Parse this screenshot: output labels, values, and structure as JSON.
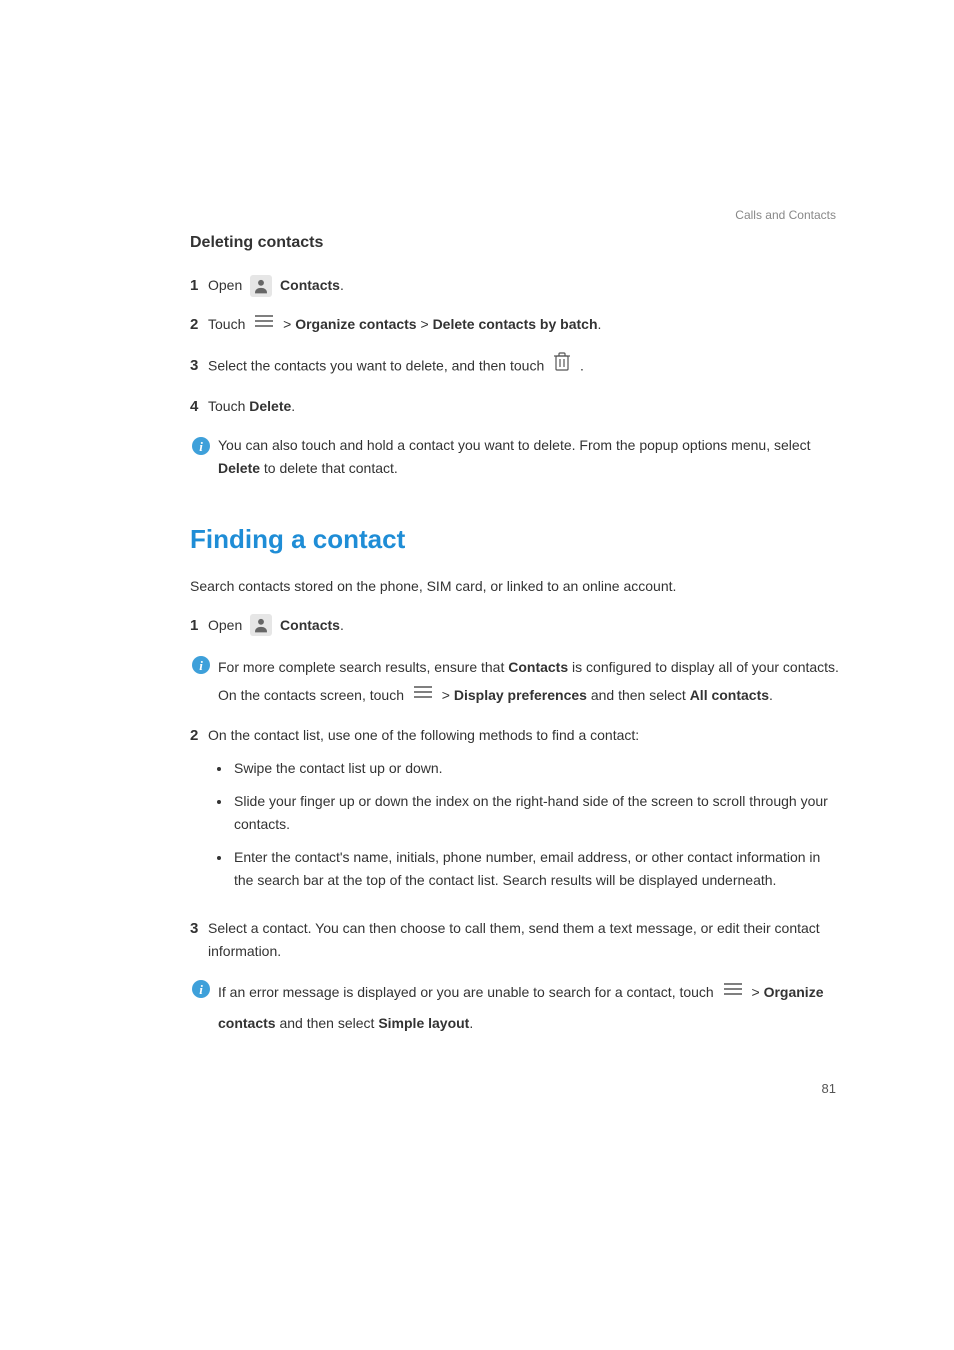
{
  "section_label": "Calls and Contacts",
  "deleting": {
    "heading": "Deleting contacts",
    "step1": {
      "num": "1",
      "open": "Open ",
      "contacts": "Contacts",
      "period": "."
    },
    "step2": {
      "num": "2",
      "touch": "Touch ",
      "gt1": " > ",
      "organize": "Organize contacts",
      "gt2": " > ",
      "delete_batch": "Delete contacts by batch",
      "period": "."
    },
    "step3": {
      "num": "3",
      "pre": "Select the contacts you want to delete, and then touch ",
      "post": " ."
    },
    "step4": {
      "num": "4",
      "touch": "Touch ",
      "delete": "Delete",
      "period": "."
    },
    "note": {
      "line1_pre": "You can also touch and hold a contact you want to delete. From the popup options menu, select ",
      "delete": "Delete",
      "line1_post": " to delete that contact."
    }
  },
  "finding": {
    "heading": "Finding a contact",
    "intro": "Search contacts stored on the phone, SIM card, or linked to an online account.",
    "step1": {
      "num": "1",
      "open": "Open ",
      "contacts": "Contacts",
      "period": "."
    },
    "note1": {
      "pre": "For more complete search results, ensure that ",
      "contacts": "Contacts",
      "mid": " is configured to display all of your contacts. On the contacts screen, touch ",
      "gt": " > ",
      "dp": "Display preferences",
      "and": " and then select ",
      "all": "All contacts",
      "period": "."
    },
    "step2": {
      "num": "2",
      "text": "On the contact list, use one of the following methods to find a contact:"
    },
    "methods": {
      "m1": "Swipe the contact list up or down.",
      "m2": "Slide your finger up or down the index on the right-hand side of the screen to scroll through your contacts.",
      "m3": "Enter the contact's name, initials, phone number, email address, or other contact information in the search bar at the top of the contact list. Search results will be displayed underneath."
    },
    "step3": {
      "num": "3",
      "text": "Select a contact. You can then choose to call them, send them a text message, or edit their contact information."
    },
    "note2": {
      "pre": "If an error message is displayed or you are unable to search for a contact, touch ",
      "gt": " > ",
      "organize": "Organize contacts",
      "and": " and then select ",
      "simple": "Simple layout",
      "period": "."
    }
  },
  "page_number": "81"
}
